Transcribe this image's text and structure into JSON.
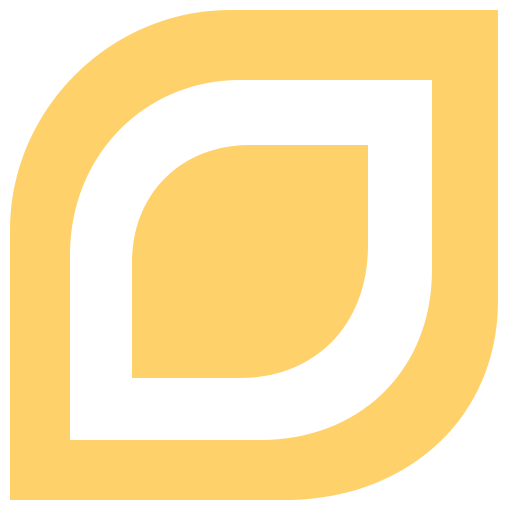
{
  "logo": {
    "icon": "leaf-logo-icon",
    "colors": {
      "primary": "#FED16B",
      "background": "#FFFFFF"
    }
  }
}
